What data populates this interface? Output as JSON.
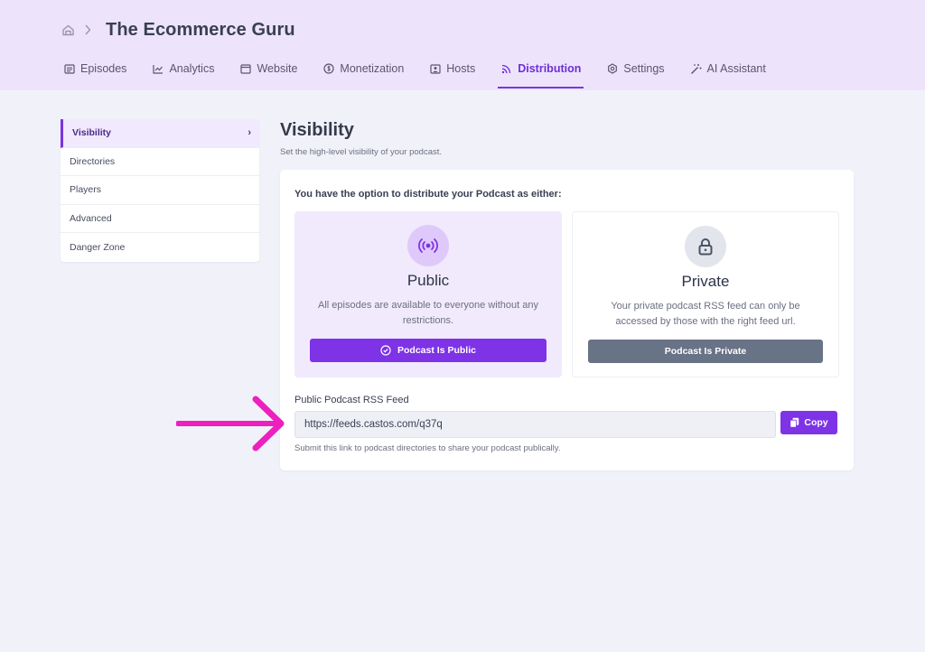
{
  "header": {
    "title": "The Ecommerce Guru",
    "home_icon": "home-icon",
    "separator_icon": "chevron-right-icon"
  },
  "tabs": [
    {
      "label": "Episodes",
      "icon": "list-icon"
    },
    {
      "label": "Analytics",
      "icon": "chart-icon"
    },
    {
      "label": "Website",
      "icon": "browser-icon"
    },
    {
      "label": "Monetization",
      "icon": "dollar-icon"
    },
    {
      "label": "Hosts",
      "icon": "person-icon"
    },
    {
      "label": "Distribution",
      "icon": "rss-icon",
      "active": true
    },
    {
      "label": "Settings",
      "icon": "gear-icon"
    },
    {
      "label": "AI Assistant",
      "icon": "magic-wand-icon"
    }
  ],
  "sidebar": {
    "items": [
      {
        "label": "Visibility",
        "active": true
      },
      {
        "label": "Directories"
      },
      {
        "label": "Players"
      },
      {
        "label": "Advanced"
      },
      {
        "label": "Danger Zone"
      }
    ]
  },
  "main": {
    "title": "Visibility",
    "subtitle": "Set the high-level visibility of your podcast.",
    "intro": "You have the option to distribute your Podcast as either:",
    "public": {
      "name": "Public",
      "description": "All episodes are available to everyone without any restrictions.",
      "button": "Podcast Is Public",
      "icon": "broadcast-icon"
    },
    "private": {
      "name": "Private",
      "description": "Your private podcast RSS feed can only be accessed by those with the right feed url.",
      "button": "Podcast Is Private",
      "icon": "lock-icon"
    },
    "feed": {
      "label": "Public Podcast RSS Feed",
      "value": "https://feeds.castos.com/q37q",
      "copy_label": "Copy",
      "help": "Submit this link to podcast directories to share your podcast publically."
    }
  },
  "colors": {
    "accent": "#7e33e6",
    "header_bg": "#ede4fb",
    "page_bg": "#f1f2f9",
    "arrow": "#ee1fbf",
    "private_button": "#697386"
  }
}
